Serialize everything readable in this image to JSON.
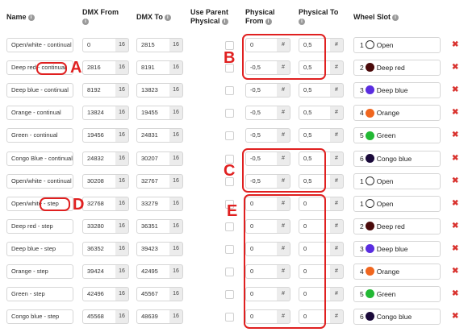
{
  "headers": {
    "name": "Name",
    "dmx_from": "DMX From",
    "dmx_to": "DMX To",
    "use_parent_line1": "Use Parent",
    "use_parent_line2": "Physical",
    "phys_from_line1": "Physical",
    "phys_from_line2": "From",
    "phys_to": "Physical To",
    "wheel_slot": "Wheel Slot"
  },
  "unit_dmx": "16",
  "unit_phys": "#",
  "rows": [
    {
      "name": "Open/white - continual",
      "dmx_from": "0",
      "dmx_to": "2815",
      "phys_from": "0",
      "phys_to": "0,5",
      "slot_num": "1",
      "slot_name": "Open",
      "slot_color": "#ffffff"
    },
    {
      "name": "Deep red - continual",
      "dmx_from": "2816",
      "dmx_to": "8191",
      "phys_from": "-0,5",
      "phys_to": "0,5",
      "slot_num": "2",
      "slot_name": "Deep red",
      "slot_color": "#4a0a0a"
    },
    {
      "name": "Deep blue - continual",
      "dmx_from": "8192",
      "dmx_to": "13823",
      "phys_from": "-0,5",
      "phys_to": "0,5",
      "slot_num": "3",
      "slot_name": "Deep blue",
      "slot_color": "#5a2de0"
    },
    {
      "name": "Orange - continual",
      "dmx_from": "13824",
      "dmx_to": "19455",
      "phys_from": "-0,5",
      "phys_to": "0,5",
      "slot_num": "4",
      "slot_name": "Orange",
      "slot_color": "#f0661e"
    },
    {
      "name": "Green - continual",
      "dmx_from": "19456",
      "dmx_to": "24831",
      "phys_from": "-0,5",
      "phys_to": "0,5",
      "slot_num": "5",
      "slot_name": "Green",
      "slot_color": "#22b834"
    },
    {
      "name": "Congo Blue - continual",
      "dmx_from": "24832",
      "dmx_to": "30207",
      "phys_from": "-0,5",
      "phys_to": "0,5",
      "slot_num": "6",
      "slot_name": "Congo blue",
      "slot_color": "#1a0a3a"
    },
    {
      "name": "Open/white - continual",
      "dmx_from": "30208",
      "dmx_to": "32767",
      "phys_from": "-0,5",
      "phys_to": "0,5",
      "slot_num": "1",
      "slot_name": "Open",
      "slot_color": "#ffffff"
    },
    {
      "name": "Open/white - step",
      "dmx_from": "32768",
      "dmx_to": "33279",
      "phys_from": "0",
      "phys_to": "0",
      "slot_num": "1",
      "slot_name": "Open",
      "slot_color": "#ffffff"
    },
    {
      "name": "Deep red - step",
      "dmx_from": "33280",
      "dmx_to": "36351",
      "phys_from": "0",
      "phys_to": "0",
      "slot_num": "2",
      "slot_name": "Deep red",
      "slot_color": "#4a0a0a"
    },
    {
      "name": "Deep blue - step",
      "dmx_from": "36352",
      "dmx_to": "39423",
      "phys_from": "0",
      "phys_to": "0",
      "slot_num": "3",
      "slot_name": "Deep blue",
      "slot_color": "#5a2de0"
    },
    {
      "name": "Orange - step",
      "dmx_from": "39424",
      "dmx_to": "42495",
      "phys_from": "0",
      "phys_to": "0",
      "slot_num": "4",
      "slot_name": "Orange",
      "slot_color": "#f0661e"
    },
    {
      "name": "Green - step",
      "dmx_from": "42496",
      "dmx_to": "45567",
      "phys_from": "0",
      "phys_to": "0",
      "slot_num": "5",
      "slot_name": "Green",
      "slot_color": "#22b834"
    },
    {
      "name": "Congo blue - step",
      "dmx_from": "45568",
      "dmx_to": "48639",
      "phys_from": "0",
      "phys_to": "0",
      "slot_num": "6",
      "slot_name": "Congo blue",
      "slot_color": "#1a0a3a"
    }
  ],
  "annotations": [
    "A",
    "B",
    "C",
    "D",
    "E"
  ],
  "colors": {
    "annotation": "#e02020",
    "delete": "#d9332f"
  }
}
